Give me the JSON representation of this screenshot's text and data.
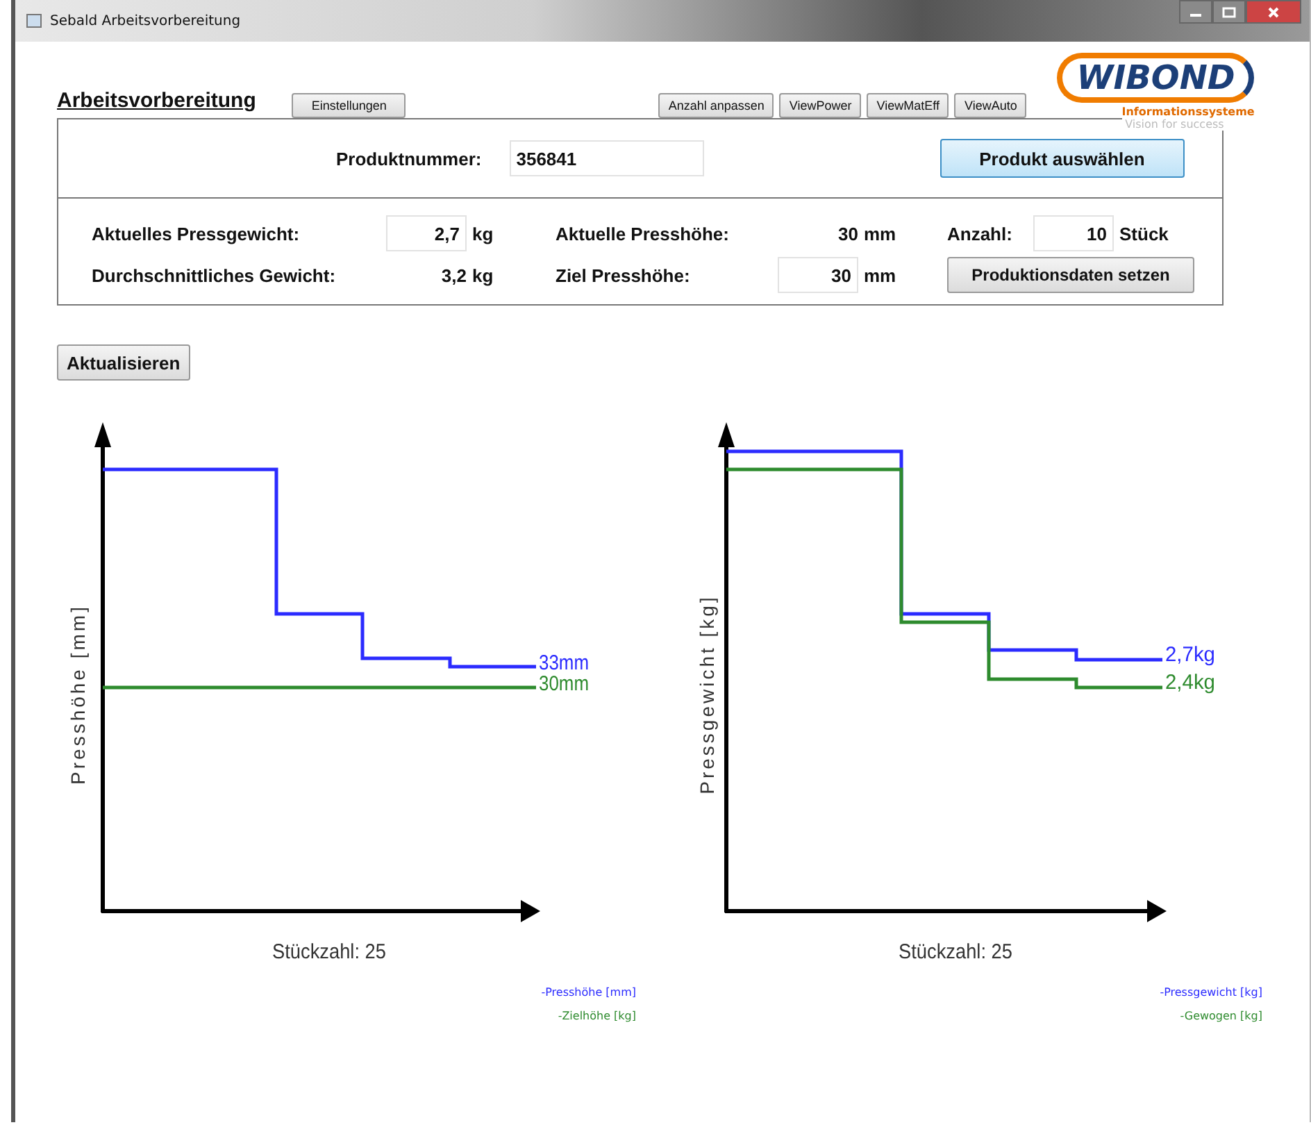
{
  "window": {
    "title": "Sebald Arbeitsvorbereitung"
  },
  "header": {
    "title": "Arbeitsvorbereitung",
    "settings_button": "Einstellungen",
    "toolbar_buttons": [
      "Anzahl anpassen",
      "ViewPower",
      "ViewMatEff",
      "ViewAuto"
    ]
  },
  "logo": {
    "name": "WIBOND",
    "subtitle": "Informationssysteme",
    "slogan": "Vision for success"
  },
  "product": {
    "label": "Produktnummer:",
    "value": "356841",
    "button": "Produkt auswählen"
  },
  "production": {
    "current_weight": {
      "label": "Aktuelles Pressgewicht:",
      "value": "2,7",
      "unit": "kg"
    },
    "average_weight": {
      "label": "Durchschnittliches Gewicht:",
      "value": "3,2",
      "unit": "kg"
    },
    "current_height": {
      "label": "Aktuelle Presshöhe:",
      "value": "30",
      "unit": "mm"
    },
    "target_height": {
      "label": "Ziel Presshöhe:",
      "value": "30",
      "unit": "mm"
    },
    "count": {
      "label": "Anzahl:",
      "value": "10",
      "unit": "Stück"
    },
    "set_button": "Produktionsdaten setzen"
  },
  "refresh_button": "Aktualisieren",
  "charts": [
    {
      "ylabel": "Presshöhe [mm]",
      "xlabel": "Stückzahl: 25",
      "series": [
        {
          "end_label": "33mm",
          "color": "#2b2bff"
        },
        {
          "end_label": "30mm",
          "color": "#2e8b2e"
        }
      ],
      "legend": [
        "-Presshöhe [mm]",
        "-Zielhöhe [kg]"
      ]
    },
    {
      "ylabel": "Pressgewicht [kg]",
      "xlabel": "Stückzahl: 25",
      "series": [
        {
          "end_label": "2,7kg",
          "color": "#2b2bff"
        },
        {
          "end_label": "2,4kg",
          "color": "#2e8b2e"
        }
      ],
      "legend": [
        "-Pressgewicht [kg]",
        "-Gewogen [kg]"
      ]
    }
  ]
}
